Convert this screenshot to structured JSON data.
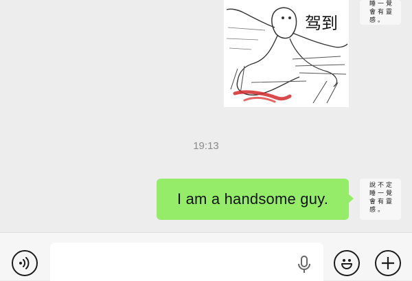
{
  "conversation": {
    "sticker": {
      "caption": "驾到",
      "icon": "sticker-image"
    },
    "timestamp": "19:13",
    "message_text": "I am a handsome guy.",
    "bubble_color": "#95ec69",
    "avatar_top_lines": [
      "睡一覺",
      "會有靈",
      "感。"
    ],
    "avatar_bottom_lines": [
      "說不定",
      "睡一覺",
      "會有靈",
      "感。"
    ]
  },
  "input_bar": {
    "value": "",
    "voice_icon": "voice-wave-icon",
    "mic_icon": "microphone-icon",
    "emoji_icon": "smiley-face-icon",
    "plus_icon": "plus-icon"
  }
}
